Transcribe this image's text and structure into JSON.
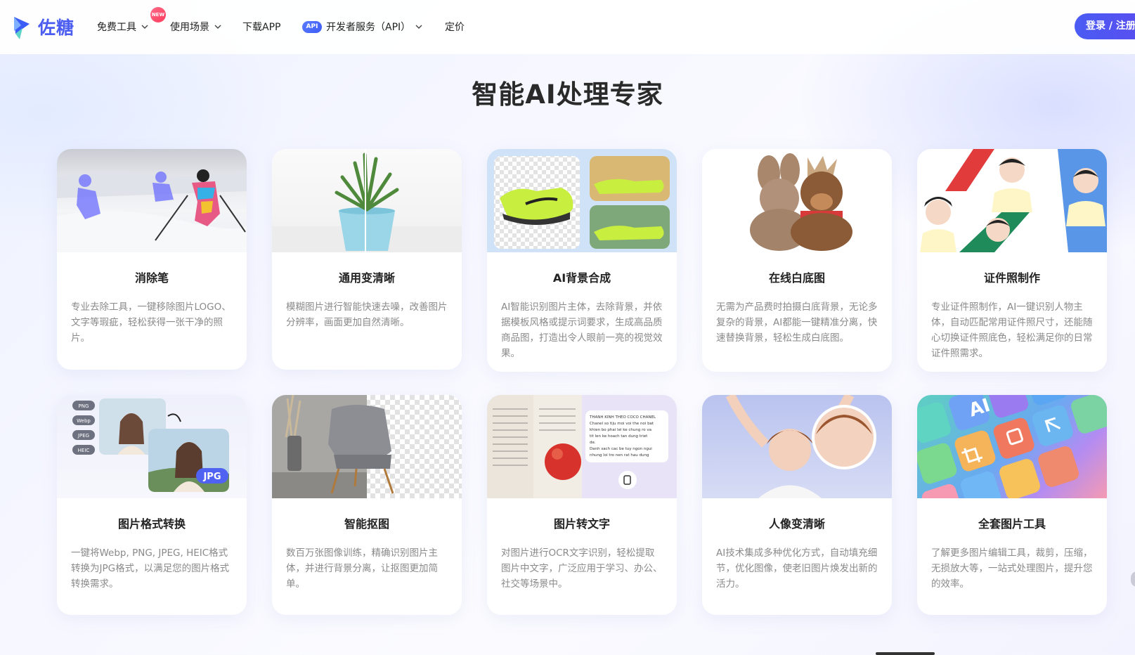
{
  "brand": {
    "name": "佐糖",
    "accent": "#4b5cf0"
  },
  "nav": {
    "items": [
      {
        "label": "免费工具",
        "has_dropdown": true
      },
      {
        "label": "使用场景",
        "has_dropdown": true
      },
      {
        "label": "下载APP",
        "has_dropdown": false
      },
      {
        "label": "开发者服务（API）",
        "has_dropdown": true
      },
      {
        "label": "定价",
        "has_dropdown": false
      }
    ],
    "new_badge": "NEW",
    "api_badge": "API",
    "login_label": "登录 / 注册"
  },
  "main": {
    "title": "智能AI处理专家",
    "cards": [
      {
        "title": "消除笔",
        "desc": "专业去除工具，一键移除图片LOGO、文字等瑕疵，轻松获得一张干净的照片。"
      },
      {
        "title": "通用变清晰",
        "desc": "模糊图片进行智能快速去噪，改善图片分辨率，画面更加自然清晰。"
      },
      {
        "title": "AI背景合成",
        "desc": "AI智能识别图片主体，去除背景，并依据模板风格或提示词要求，生成高品质商品图，打造出令人眼前一亮的视觉效果。"
      },
      {
        "title": "在线白底图",
        "desc": "无需为产品费时拍摄白底背景，无论多复杂的背景，AI都能一键精准分离，快速替换背景，轻松生成白底图。"
      },
      {
        "title": "证件照制作",
        "desc": "专业证件照制作，AI一键识别人物主体，自动匹配常用证件照尺寸，还能随心切换证件照底色，轻松满足你的日常证件照需求。"
      },
      {
        "title": "图片格式转换",
        "desc": "一键将Webp, PNG, JPEG, HEIC格式转换为JPG格式，以满足您的图片格式转换需求。"
      },
      {
        "title": "智能抠图",
        "desc": "数百万张图像训练，精确识别图片主体，并进行背景分离，让抠图更加简单。"
      },
      {
        "title": "图片转文字",
        "desc": "对图片进行OCR文字识别，轻松提取图片中文字，广泛应用于学习、办公、社交等场景中。"
      },
      {
        "title": "人像变清晰",
        "desc": "AI技术集成多种优化方式，自动填充细节，优化图像，使老旧图片焕发出新的活力。"
      },
      {
        "title": "全套图片工具",
        "desc": "了解更多图片编辑工具，裁剪，压缩，无损放大等，一站式处理图片，提升您的效率。"
      }
    ],
    "format_tags": [
      "PNG",
      "Webp",
      "JPEG",
      "HEIC"
    ],
    "jpg_tag": "JPG",
    "ocr_text": [
      "THANH KINH THEO COCO CHANEL",
      "Chanel so tiju moi voi the noi bat",
      "khien bo phai lei ke chung ro va",
      "tit len ke hoach tan dung triet",
      "de.",
      "Danh sach cac be tuy ngon ngui",
      "nhung loi tro nen rat hau dung"
    ],
    "tool_icon_text": "AI"
  }
}
